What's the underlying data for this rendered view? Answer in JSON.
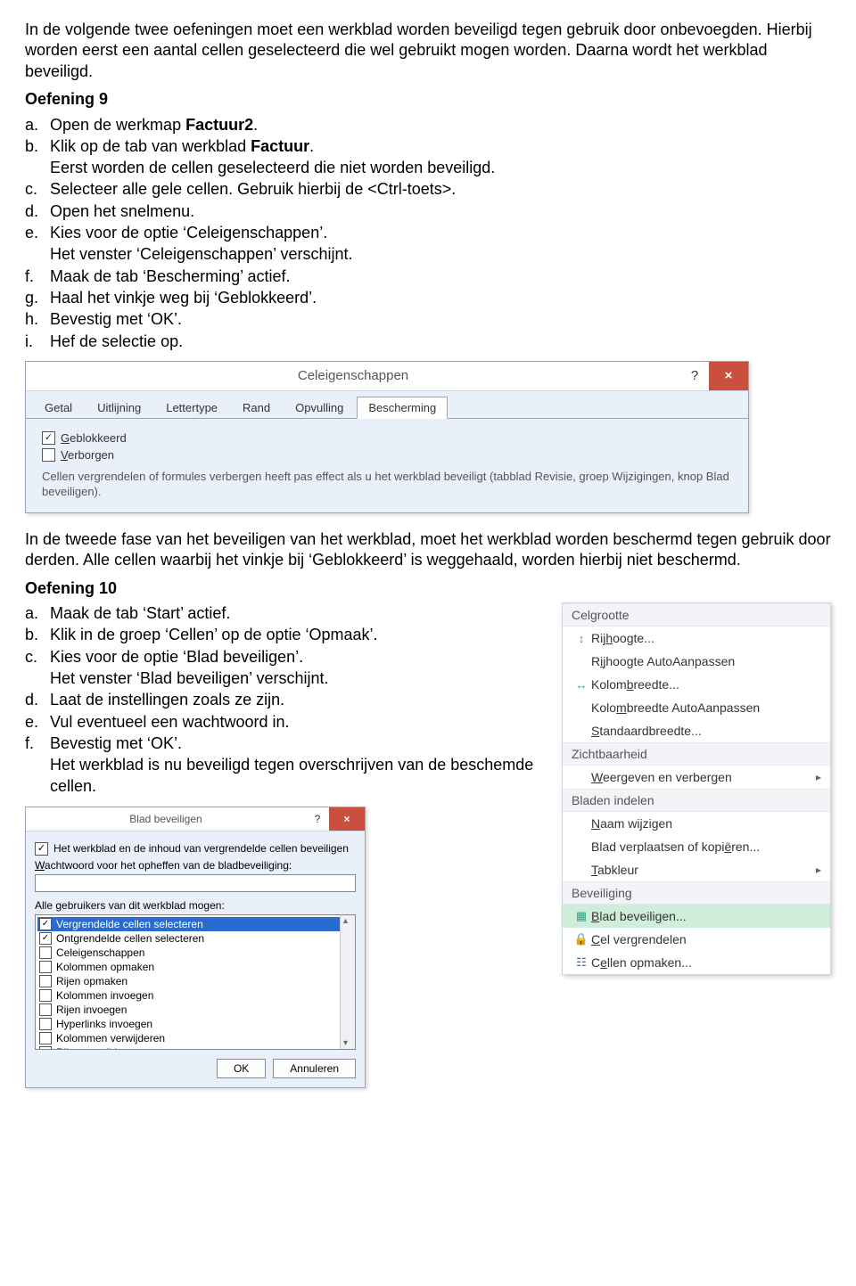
{
  "intro": {
    "p1": "In de volgende twee oefeningen moet een werkblad worden beveiligd tegen gebruik door onbevoegden. Hierbij worden eerst een aantal cellen geselecteerd die wel gebruikt mogen worden. Daarna wordt het werkblad beveiligd."
  },
  "oef9": {
    "title": "Oefening 9",
    "items": {
      "a": {
        "pre": "Open de werkmap ",
        "bold": "Factuur2",
        "post": "."
      },
      "b": {
        "pre": "Klik op de tab van werkblad ",
        "bold": "Factuur",
        "post": ".",
        "sub": "Eerst worden de cellen geselecteerd die niet worden beveiligd."
      },
      "c": "Selecteer alle gele cellen. Gebruik hierbij de <Ctrl-toets>.",
      "d": "Open het snelmenu.",
      "e": {
        "text": "Kies voor de optie ‘Celeigenschappen’.",
        "sub": "Het venster ‘Celeigenschappen’ verschijnt."
      },
      "f": "Maak de tab ‘Bescherming’ actief.",
      "g": "Haal het vinkje weg bij ‘Geblokkeerd’.",
      "h": "Bevestig met ‘OK’.",
      "i": "Hef de selectie op."
    }
  },
  "celDialog": {
    "title": "Celeigenschappen",
    "help": "?",
    "close": "×",
    "tabs": [
      "Getal",
      "Uitlijning",
      "Lettertype",
      "Rand",
      "Opvulling",
      "Bescherming"
    ],
    "selectedTab": 5,
    "geblokkeerd": {
      "label": "Geblokkeerd",
      "checked": true,
      "accel": "G"
    },
    "verborgen": {
      "label": "Verborgen",
      "checked": false,
      "accel": "V"
    },
    "note": "Cellen vergrendelen of formules verbergen heeft pas effect als u het werkblad beveiligt (tabblad Revisie, groep Wijzigingen, knop Blad beveiligen)."
  },
  "mid": {
    "p": "In de tweede fase van het beveiligen van het werkblad, moet het werkblad worden beschermd tegen gebruik door derden. Alle cellen waarbij het vinkje bij ‘Geblokkeerd’ is weggehaald, worden hierbij niet beschermd."
  },
  "oef10": {
    "title": "Oefening 10",
    "items": {
      "a": "Maak de tab ‘Start’ actief.",
      "b": "Klik in de groep ‘Cellen’ op de optie ‘Opmaak’.",
      "c": {
        "text": "Kies voor de optie ‘Blad beveiligen’.",
        "sub": "Het venster ‘Blad beveiligen’ verschijnt."
      },
      "d": "Laat de instellingen zoals ze zijn.",
      "e": "Vul eventueel een wachtwoord in.",
      "f": {
        "text": "Bevestig met ‘OK’.",
        "sub": "Het werkblad is nu beveiligd tegen overschrijven van de beschemde cellen."
      }
    }
  },
  "formatMenu": {
    "sections": {
      "celgrootte": "Celgrootte",
      "zichtbaarheid": "Zichtbaarheid",
      "bladen": "Bladen indelen",
      "beveiliging": "Beveiliging"
    },
    "items": {
      "rijhoogte": "Rijhoogte...",
      "rijhoogteAuto": "Rijhoogte AutoAanpassen",
      "kolombreedte": "Kolombreedte...",
      "kolombreedteAuto": "Kolombreedte AutoAanpassen",
      "standaard": "Standaardbreedte...",
      "weergeven": "Weergeven en verbergen",
      "naam": "Naam wijzigen",
      "verplaatsen": "Blad verplaatsen of kopiëren...",
      "tabkleur": "Tabkleur",
      "bladBeveiligen": "Blad beveiligen...",
      "celVergrendelen": "Cel vergrendelen",
      "cellenOpmaken": "Cellen opmaken..."
    }
  },
  "bevDialog": {
    "title": "Blad beveiligen",
    "help": "?",
    "close": "×",
    "topCheck": {
      "label": "Het werkblad en de inhoud van vergrendelde cellen beveiligen",
      "checked": true
    },
    "pwLabel": "Wachtwoord voor het opheffen van de bladbeveiliging:",
    "pwValue": "",
    "listLabel": "Alle gebruikers van dit werkblad mogen:",
    "options": [
      {
        "label": "Vergrendelde cellen selecteren",
        "checked": true,
        "selected": true
      },
      {
        "label": "Ontgrendelde cellen selecteren",
        "checked": true
      },
      {
        "label": "Celeigenschappen",
        "checked": false
      },
      {
        "label": "Kolommen opmaken",
        "checked": false
      },
      {
        "label": "Rijen opmaken",
        "checked": false
      },
      {
        "label": "Kolommen invoegen",
        "checked": false
      },
      {
        "label": "Rijen invoegen",
        "checked": false
      },
      {
        "label": "Hyperlinks invoegen",
        "checked": false
      },
      {
        "label": "Kolommen verwijderen",
        "checked": false
      },
      {
        "label": "Rijen verwijderen",
        "checked": false
      }
    ],
    "ok": "OK",
    "cancel": "Annuleren"
  }
}
